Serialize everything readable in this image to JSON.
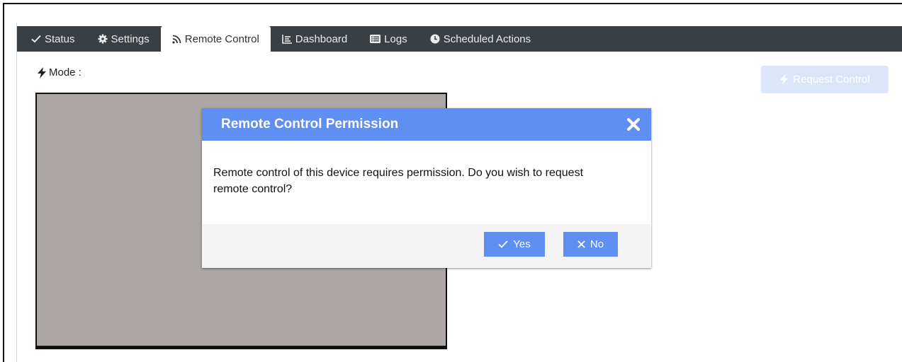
{
  "tabs": [
    {
      "label": "Status",
      "icon": "check-icon"
    },
    {
      "label": "Settings",
      "icon": "gear-icon"
    },
    {
      "label": "Remote Control",
      "icon": "rss-icon",
      "active": true
    },
    {
      "label": "Dashboard",
      "icon": "dashboard-icon"
    },
    {
      "label": "Logs",
      "icon": "list-icon"
    },
    {
      "label": "Scheduled Actions",
      "icon": "clock-icon"
    }
  ],
  "mode": {
    "label": "Mode :",
    "icon": "bolt-icon"
  },
  "request_control": {
    "label": "Request Control",
    "icon": "bolt-icon",
    "state": "disabled"
  },
  "dialog": {
    "title": "Remote Control Permission",
    "message": "Remote control of this device requires permission. Do you wish to request remote control?",
    "yes_label": "Yes",
    "no_label": "No"
  },
  "colors": {
    "tabbar": "#3a3f44",
    "dialog_accent": "#5f8ff2",
    "screen": "#aca6a4",
    "request_disabled": "#dce6fb"
  }
}
